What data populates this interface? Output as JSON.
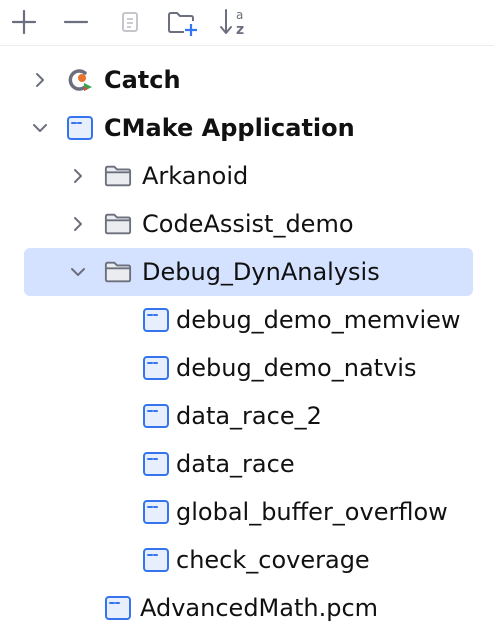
{
  "toolbar": {
    "buttons": [
      {
        "name": "add",
        "icon": "plus-icon"
      },
      {
        "name": "remove",
        "icon": "minus-icon"
      },
      {
        "name": "copy",
        "icon": "copy-icon"
      },
      {
        "name": "new-folder",
        "icon": "folder-plus-icon"
      },
      {
        "name": "sort",
        "icon": "sort-alphabetically-icon"
      }
    ],
    "sort_glyph_top": "a",
    "sort_glyph_bottom": "z"
  },
  "tree": {
    "items": [
      {
        "label": "Catch",
        "level": 0,
        "expanded": false,
        "icon": "catch-logo-icon",
        "bold": true
      },
      {
        "label": "CMake Application",
        "level": 0,
        "expanded": true,
        "icon": "cmake-config-icon",
        "bold": true
      },
      {
        "label": "Arkanoid",
        "level": 1,
        "expanded": false,
        "icon": "folder-icon"
      },
      {
        "label": "CodeAssist_demo",
        "level": 1,
        "expanded": false,
        "icon": "folder-icon"
      },
      {
        "label": "Debug_DynAnalysis",
        "level": 1,
        "expanded": true,
        "icon": "folder-icon",
        "selected": true
      },
      {
        "label": "debug_demo_memview",
        "level": 2,
        "icon": "config-icon"
      },
      {
        "label": "debug_demo_natvis",
        "level": 2,
        "icon": "config-icon"
      },
      {
        "label": "data_race_2",
        "level": 2,
        "icon": "config-icon"
      },
      {
        "label": "data_race",
        "level": 2,
        "icon": "config-icon"
      },
      {
        "label": "global_buffer_overflow",
        "level": 2,
        "icon": "config-icon"
      },
      {
        "label": "check_coverage",
        "level": 2,
        "icon": "config-icon"
      },
      {
        "label": "AdvancedMath.pcm",
        "level": 1,
        "icon": "config-icon"
      }
    ]
  },
  "colors": {
    "selection": "#d4e2ff",
    "icon_gray": "#6c707e",
    "config_blue": "#3574f0",
    "catch_orange": "#e8732c",
    "catch_green": "#3ea34f",
    "catch_red": "#d94b3b"
  }
}
